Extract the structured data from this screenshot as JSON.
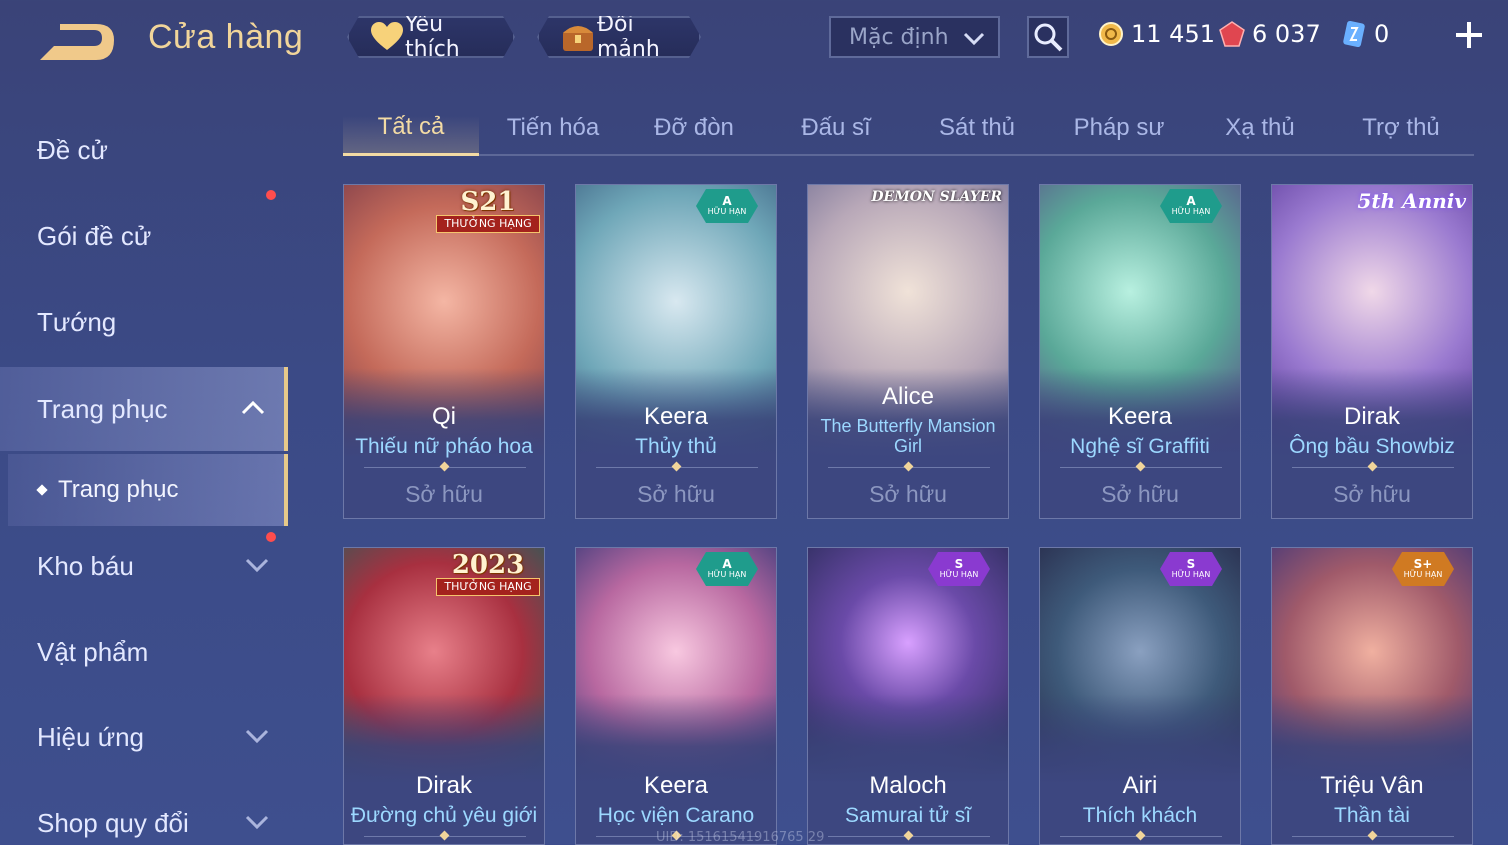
{
  "header": {
    "title": "Cửa hàng",
    "favorites_label": "Yêu thích",
    "exchange_label": "Đổi mảnh",
    "sort_value": "Mặc định",
    "currencies": [
      {
        "name": "gold-coin-icon",
        "value": "11 451"
      },
      {
        "name": "red-gem-icon",
        "value": "6 037"
      },
      {
        "name": "voucher-icon",
        "value": "0"
      }
    ]
  },
  "sidebar": {
    "items": [
      {
        "label": "Đề cử"
      },
      {
        "label": "Gói đề cử",
        "notify": true
      },
      {
        "label": "Tướng"
      },
      {
        "label": "Trang phục",
        "expanded": true,
        "active": true
      },
      {
        "label": "Trang phục",
        "sub": true,
        "active": true
      },
      {
        "label": "Kho báu",
        "notify": true
      },
      {
        "label": "Vật phẩm"
      },
      {
        "label": "Hiệu ứng"
      },
      {
        "label": "Shop quy đổi"
      }
    ]
  },
  "tabs": [
    "Tất cả",
    "Tiến hóa",
    "Đỡ đòn",
    "Đấu sĩ",
    "Sát thủ",
    "Pháp sư",
    "Xạ thủ",
    "Trợ thủ"
  ],
  "active_tab": "Tất cả",
  "cards": [
    {
      "hero": "Qi",
      "skin": "Thiếu nữ pháo hoa",
      "status": "Sở hữu",
      "badge_year": "S21",
      "badge_label": "THƯỞNG HẠNG",
      "color": "#c46a5a"
    },
    {
      "hero": "Keera",
      "skin": "Thủy thủ",
      "status": "Sở hữu",
      "tier": "A",
      "tier_label": "HỮU HẠN",
      "color": "#6fa7b8"
    },
    {
      "hero": "Alice",
      "skin": "The Butterfly Mansion Girl",
      "status": "Sở hữu",
      "logo": "DEMON SLAYER",
      "color": "#9a8fa8"
    },
    {
      "hero": "Keera",
      "skin": "Nghệ sĩ Graffiti",
      "status": "Sở hữu",
      "tier": "A",
      "tier_label": "HỮU HẠN",
      "color": "#5aa898"
    },
    {
      "hero": "Dirak",
      "skin": "Ông bầu Showbiz",
      "status": "Sở hữu",
      "logo": "5th Anniv",
      "color": "#7a62b8"
    },
    {
      "hero": "Dirak",
      "skin": "Đường chủ yêu giới",
      "badge_year": "2023",
      "badge_label": "THƯỞNG HẠNG",
      "color": "#a83040"
    },
    {
      "hero": "Keera",
      "skin": "Học viện Carano",
      "tier": "A",
      "tier_label": "HỮU HẠN",
      "color": "#b868a0"
    },
    {
      "hero": "Maloch",
      "skin": "Samurai tử sĩ",
      "tier": "S",
      "tier_label": "HỮU HẠN",
      "color": "#4a4a8a"
    },
    {
      "hero": "Airi",
      "skin": "Thích khách",
      "tier": "S",
      "tier_label": "HỮU HẠN",
      "color": "#3e5a7a"
    },
    {
      "hero": "Triệu Vân",
      "skin": "Thần tài",
      "tier": "S+",
      "tier_label": "HỮU HẠN",
      "color": "#a05a6a"
    }
  ],
  "colors": {
    "accent_gold": "#f1d59a",
    "skin_name_blue": "#9cd8ff",
    "tier_a": "#1f9c8c",
    "tier_s": "#8a3ad0",
    "tier_splus": "#d07a22"
  },
  "watermark": "UID: 15161541916765 29"
}
